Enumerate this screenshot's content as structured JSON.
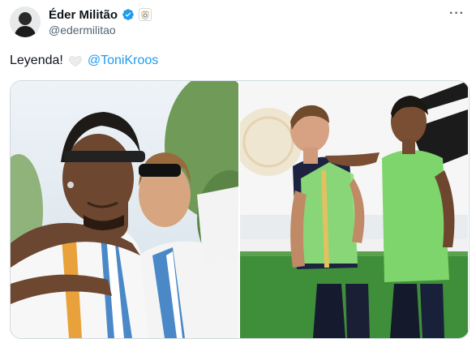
{
  "author": {
    "name": "Éder Militão",
    "handle": "@edermilitao",
    "verified": true,
    "affiliate_badge": "real-madrid-crest-icon"
  },
  "tweet": {
    "text": "Leyenda!",
    "emoji": "white-heart-icon",
    "mention": "@ToniKroos"
  },
  "menu": {
    "more_label": "···"
  },
  "media": [
    {
      "label": "photo-militao-kroos-celebration"
    },
    {
      "label": "photo-kroos-militao-training"
    }
  ],
  "colors": {
    "accent": "#1d9bf0",
    "text": "#0f1419",
    "muted": "#536471",
    "pitch": "#3f8f3a",
    "bib": "#8ee07a"
  }
}
